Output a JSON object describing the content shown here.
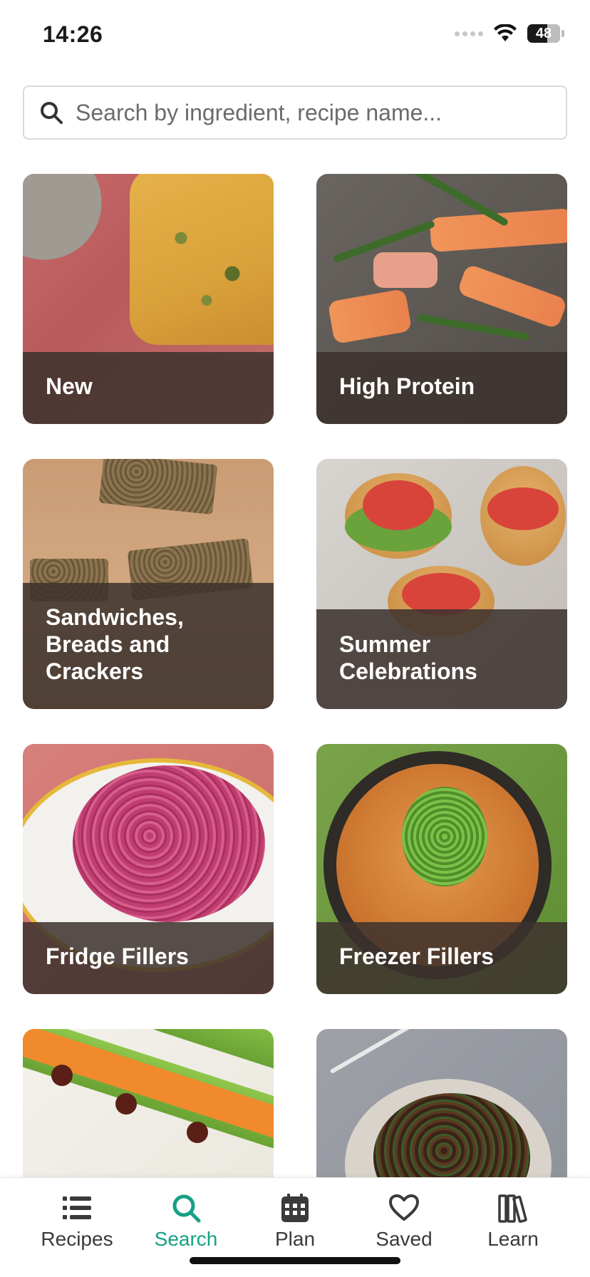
{
  "status_bar": {
    "time": "14:26",
    "battery_level": "48"
  },
  "search": {
    "placeholder": "Search by ingredient, recipe name..."
  },
  "categories": [
    {
      "label": "New"
    },
    {
      "label": "High Protein"
    },
    {
      "label": "Sandwiches, Breads and Crackers"
    },
    {
      "label": "Summer Celebrations"
    },
    {
      "label": "Fridge Fillers"
    },
    {
      "label": "Freezer Fillers"
    },
    {
      "label": ""
    },
    {
      "label": ""
    }
  ],
  "bottom_nav": {
    "items": [
      {
        "label": "Recipes",
        "icon": "list-icon"
      },
      {
        "label": "Search",
        "icon": "search-icon"
      },
      {
        "label": "Plan",
        "icon": "calendar-icon"
      },
      {
        "label": "Saved",
        "icon": "heart-icon"
      },
      {
        "label": "Learn",
        "icon": "books-icon"
      }
    ],
    "active": "Search"
  },
  "colors": {
    "accent": "#16a085",
    "overlay": "#3c322d",
    "text_dark": "#3a3a3a"
  }
}
